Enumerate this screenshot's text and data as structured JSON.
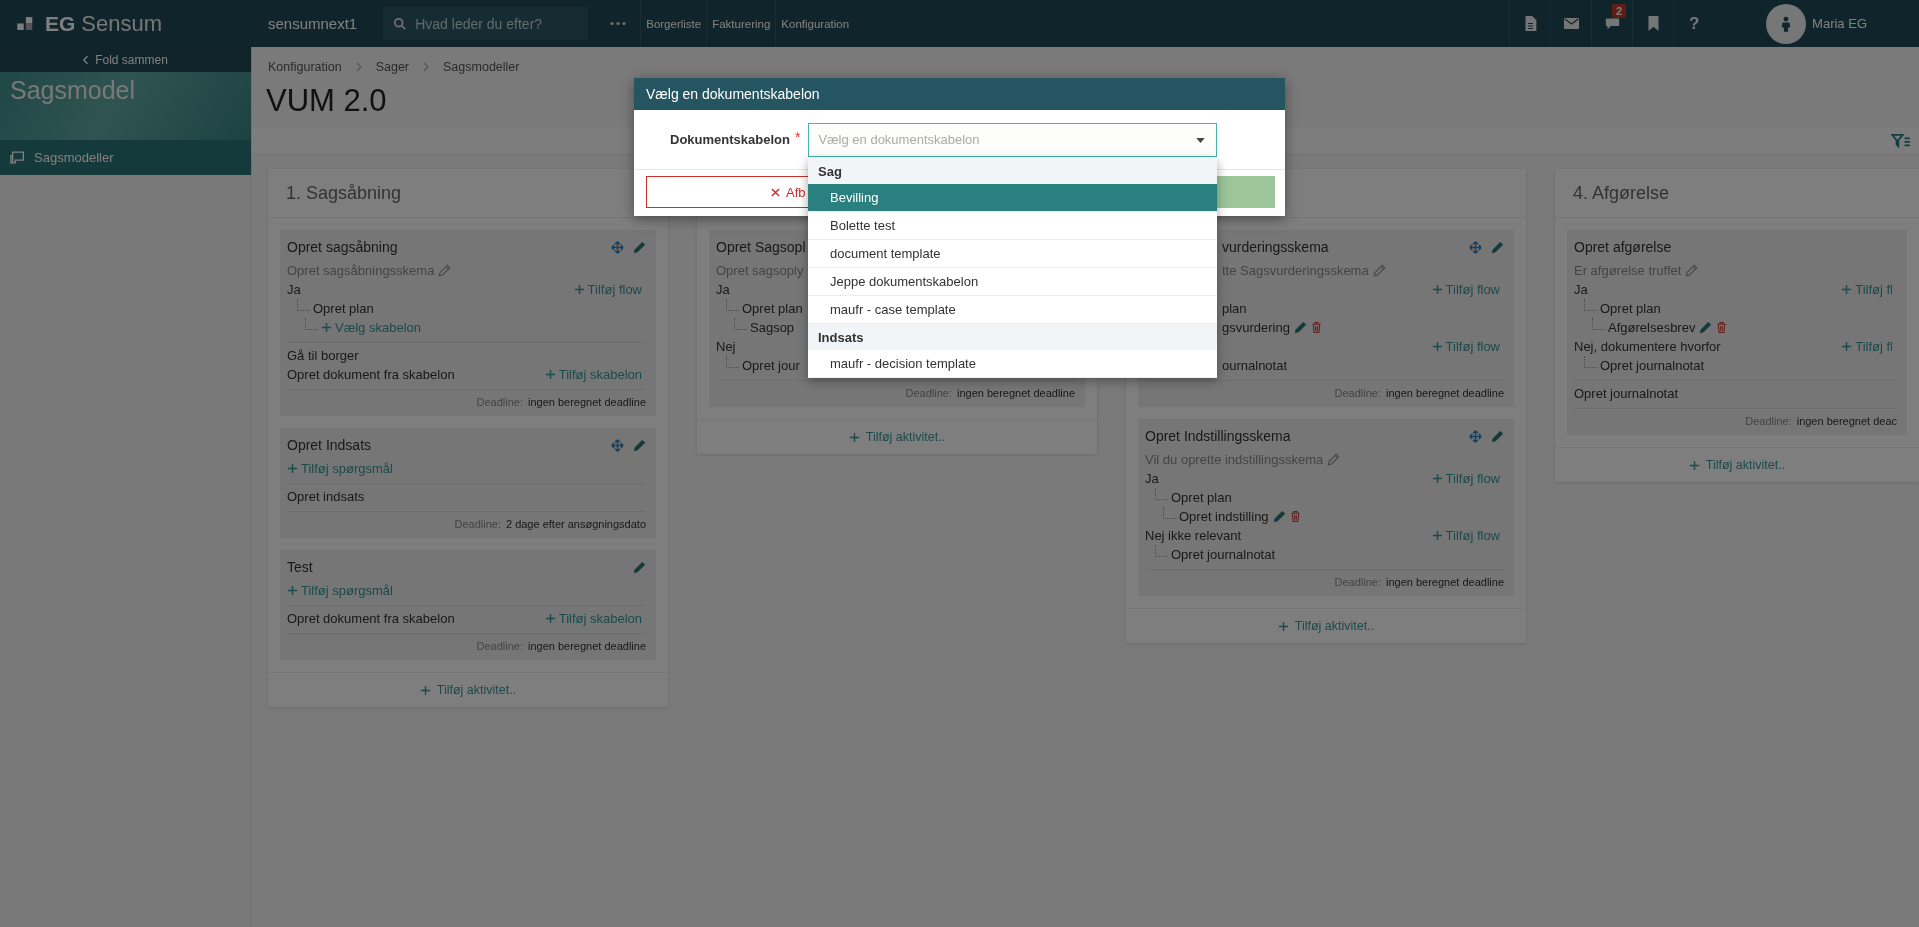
{
  "topbar": {
    "logo_mark": "EG",
    "logo_text": "Sensum",
    "instance": "sensumnext1",
    "search": {
      "placeholder": "Hvad leder du efter?"
    },
    "nav": [
      "Borgerliste",
      "Fakturering",
      "Konfiguration"
    ],
    "tools": [
      {
        "kind": "document"
      },
      {
        "kind": "mail"
      },
      {
        "kind": "chat",
        "badge": "2"
      },
      {
        "kind": "bookmark"
      },
      {
        "kind": "help",
        "label": "?"
      }
    ],
    "user": "Maria EG"
  },
  "sidebar": {
    "collapse": "Fold sammen",
    "banner": "Sagsmodel",
    "items": [
      {
        "label": "Sagsmodeller",
        "selected": true
      }
    ]
  },
  "breadcrumb": [
    "Konfiguration",
    "Sager",
    "Sagsmodeller"
  ],
  "title": "VUM 2.0",
  "columns": [
    {
      "title": "1. Sagsåbning",
      "menu": false,
      "add_label": "Tilføj aktivitet..",
      "cards": [
        {
          "title": "Opret sagsåbning",
          "movable": true,
          "editable": true,
          "sections": [
            [
              {
                "kind": "question",
                "text": "Opret sagsåbningsskema",
                "editable": true
              },
              {
                "kind": "answer",
                "text": "Ja",
                "action": "Tilføj flow",
                "children": [
                  {
                    "kind": "node",
                    "text": "Opret plan",
                    "children": [
                      {
                        "kind": "add",
                        "text": "Vælg skabelon"
                      }
                    ]
                  }
                ]
              }
            ],
            [
              {
                "kind": "step",
                "text": "Gå til borger"
              },
              {
                "kind": "step",
                "text": "Opret dokument fra skabelon",
                "action": "Tilføj skabelon"
              }
            ]
          ],
          "deadline": {
            "label": "Deadline:",
            "value": "ingen beregnet deadline"
          }
        },
        {
          "title": "Opret Indsats",
          "movable": true,
          "editable": true,
          "sections": [
            [
              {
                "kind": "add",
                "text": "Tilføj spørgsmål"
              }
            ],
            [
              {
                "kind": "step",
                "text": "Opret indsats"
              }
            ]
          ],
          "deadline": {
            "label": "Deadline:",
            "value": "2 dage efter ansøgningsdato"
          }
        },
        {
          "title": "Test",
          "movable": false,
          "editable": true,
          "sections": [
            [
              {
                "kind": "add",
                "text": "Tilføj spørgsmål"
              }
            ],
            [
              {
                "kind": "step",
                "text": "Opret dokument fra skabelon",
                "action": "Tilføj skabelon"
              }
            ]
          ],
          "deadline": {
            "label": "Deadline:",
            "value": "ingen beregnet deadline"
          }
        }
      ]
    },
    {
      "add_label": "Tilføj aktivitet..",
      "cards": [
        {
          "title": "Opret Sagsopl",
          "sections": [
            [
              {
                "kind": "question",
                "text": "Opret sagsoply"
              },
              {
                "kind": "answer",
                "text": "Ja",
                "children": [
                  {
                    "kind": "node",
                    "text": "Opret plan",
                    "children": [
                      {
                        "kind": "node",
                        "text": "Sagsop"
                      }
                    ]
                  }
                ]
              },
              {
                "kind": "answer",
                "text": "Nej",
                "children": [
                  {
                    "kind": "node",
                    "text": "Opret jour"
                  }
                ]
              }
            ]
          ],
          "deadline": {
            "label": "Deadline:",
            "value": "ingen beregnet deadline"
          }
        }
      ]
    },
    {
      "menu": true,
      "add_label": "Tilføj aktivitet..",
      "cards": [
        {
          "title": "vurderingsskema",
          "movable": true,
          "editable": true,
          "sections": [
            [
              {
                "kind": "question",
                "text": "tte Sagsvurderingsskema",
                "editable": true
              },
              {
                "kind": "answer",
                "action": "Tilføj flow",
                "children": [
                  {
                    "kind": "node",
                    "text": "plan",
                    "children": [
                      {
                        "kind": "document",
                        "text": "gsvurdering"
                      }
                    ]
                  }
                ]
              },
              {
                "kind": "answer",
                "action": "Tilføj flow",
                "children": [
                  {
                    "kind": "node",
                    "text": "ournalnotat"
                  }
                ]
              }
            ]
          ],
          "deadline": {
            "label": "Deadline:",
            "value": "ingen beregnet deadline"
          }
        },
        {
          "title": "Opret Indstillingsskema",
          "movable": true,
          "editable": true,
          "sections": [
            [
              {
                "kind": "question",
                "text": "Vil du oprette indstillingsskema",
                "editable": true
              },
              {
                "kind": "answer",
                "text": "Ja",
                "action": "Tilføj flow",
                "children": [
                  {
                    "kind": "node",
                    "text": "Opret plan",
                    "children": [
                      {
                        "kind": "document",
                        "text": "Opret indstilling"
                      }
                    ]
                  }
                ]
              },
              {
                "kind": "answer",
                "text": "Nej ikke relevant",
                "action": "Tilføj flow",
                "children": [
                  {
                    "kind": "node",
                    "text": "Opret journalnotat"
                  }
                ]
              }
            ]
          ],
          "deadline": {
            "label": "Deadline:",
            "value": "ingen beregnet deadline"
          }
        }
      ]
    },
    {
      "title": "4. Afgørelse",
      "menu": false,
      "add_label": "Tilføj aktivitet..",
      "cards": [
        {
          "title": "Opret afgørelse",
          "movable": false,
          "editable": false,
          "sections": [
            [
              {
                "kind": "question",
                "text": "Er afgørelse truffet",
                "editable": true
              },
              {
                "kind": "answer",
                "text": "Ja",
                "action": "Tilføj fl",
                "children": [
                  {
                    "kind": "node",
                    "text": "Opret plan",
                    "children": [
                      {
                        "kind": "document",
                        "text": "Afgørelsesbrev"
                      }
                    ]
                  }
                ]
              },
              {
                "kind": "answer",
                "text": "Nej, dokumentere hvorfor",
                "action": "Tilføj fl",
                "children": [
                  {
                    "kind": "node",
                    "text": "Opret journalnotat"
                  }
                ]
              }
            ],
            [
              {
                "kind": "step",
                "text": "Opret journalnotat"
              }
            ]
          ],
          "deadline": {
            "label": "Deadline:",
            "value": "ingen beregnet deac"
          }
        }
      ]
    }
  ],
  "dialog": {
    "title": "Vælg en dokumentskabelon",
    "field": {
      "label": "Dokumentskabelon",
      "required_mark": "*",
      "placeholder": "Vælg en dokumentskabelon",
      "expanded": true
    },
    "groups": [
      {
        "label": "Sag",
        "options": [
          {
            "label": "Bevilling",
            "selected": true
          },
          {
            "label": "Bolette test",
            "selected": false
          },
          {
            "label": "document template",
            "selected": false
          },
          {
            "label": "Jeppe dokumentskabelon",
            "selected": false
          },
          {
            "label": "maufr - case template",
            "selected": false
          }
        ]
      },
      {
        "label": "Indsats",
        "options": [
          {
            "label": "maufr - decision template",
            "selected": false
          }
        ]
      }
    ],
    "cancel": "Afb"
  }
}
